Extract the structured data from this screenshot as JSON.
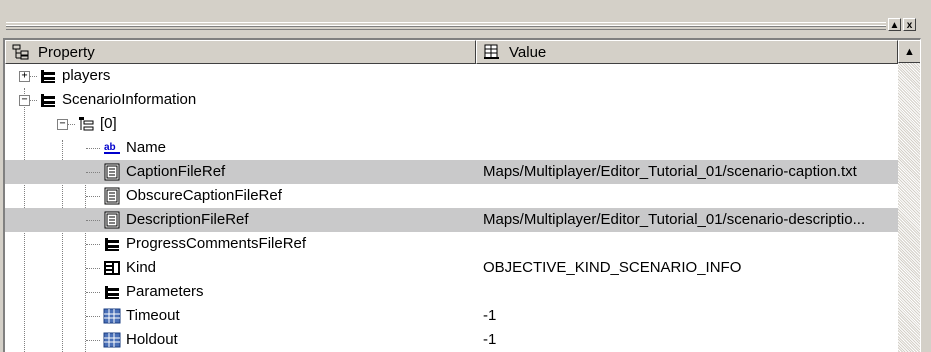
{
  "header": {
    "property_label": "Property",
    "value_label": "Value"
  },
  "window_buttons": {
    "restore": "▲",
    "close": "x"
  },
  "scroll": {
    "up_arrow": "▲"
  },
  "rows": [
    {
      "label": "players",
      "value": "",
      "icon": "folder-icon",
      "expander": "+"
    },
    {
      "label": "ScenarioInformation",
      "value": "",
      "icon": "folder-icon",
      "expander": "−"
    },
    {
      "label": "[0]",
      "value": "",
      "icon": "tree-node-icon",
      "expander": "−"
    },
    {
      "label": "Name",
      "value": "",
      "icon": "string-ab-icon"
    },
    {
      "label": "CaptionFileRef",
      "value": "Maps/Multiplayer/Editor_Tutorial_01/scenario-caption.txt",
      "icon": "document-icon",
      "selected": true
    },
    {
      "label": "ObscureCaptionFileRef",
      "value": "",
      "icon": "document-icon"
    },
    {
      "label": "DescriptionFileRef",
      "value": "Maps/Multiplayer/Editor_Tutorial_01/scenario-descriptio...",
      "icon": "document-icon",
      "selected": true
    },
    {
      "label": "ProgressCommentsFileRef",
      "value": "",
      "icon": "folder-icon"
    },
    {
      "label": "Kind",
      "value": "OBJECTIVE_KIND_SCENARIO_INFO",
      "icon": "enum-icon"
    },
    {
      "label": "Parameters",
      "value": "",
      "icon": "folder-icon"
    },
    {
      "label": "Timeout",
      "value": "-1",
      "icon": "number-grid-icon"
    },
    {
      "label": "Holdout",
      "value": "-1",
      "icon": "number-grid-icon"
    }
  ]
}
